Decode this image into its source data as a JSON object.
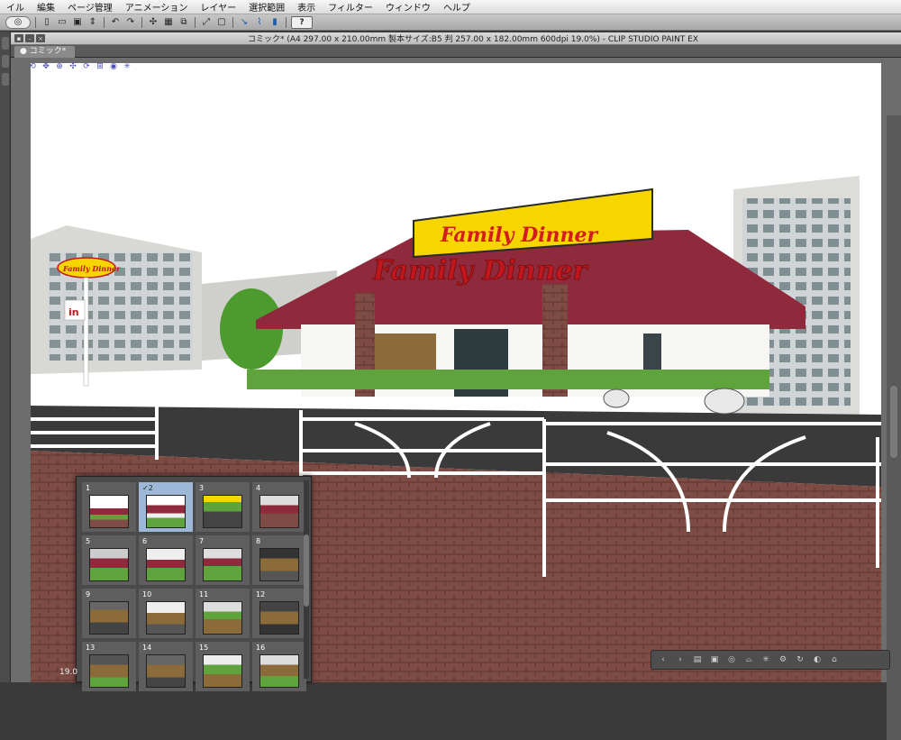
{
  "menubar": {
    "items": [
      "イル",
      "編集",
      "ページ管理",
      "アニメーション",
      "レイヤー",
      "選択範囲",
      "表示",
      "フィルター",
      "ウィンドウ",
      "ヘルプ"
    ]
  },
  "toolbar": {
    "icons": [
      "clip-studio-logo-icon",
      "new-file-icon",
      "open-file-icon",
      "save-icon",
      "undo-icon",
      "redo-icon",
      "transform-icon",
      "fit-icon",
      "crop-icon",
      "ruler-icon",
      "pen-icon",
      "help-icon"
    ],
    "help_label": "?"
  },
  "document": {
    "title": "コミック* (A4 297.00 x 210.00mm 製本サイズ:B5 判 257.00 x 182.00mm 600dpi 19.0%)  - CLIP STUDIO PAINT EX",
    "tab_label": "コミック*",
    "zoom_readout": "19.0"
  },
  "scene": {
    "sign_label": "Family Dinner",
    "pole_sign_label": "Family Dinner",
    "entrance_label": "in",
    "colors": {
      "roof": "#8f2a3c",
      "sign_bg": "#f7d600",
      "sign_text": "#d21d1d",
      "brick": "#7e4b45",
      "sky": "#ffffff"
    }
  },
  "page_thumbnails": {
    "selected": 2,
    "pages": [
      {
        "number": "1",
        "checked": false
      },
      {
        "number": "2",
        "checked": true
      },
      {
        "number": "3",
        "checked": false
      },
      {
        "number": "4",
        "checked": false
      },
      {
        "number": "5",
        "checked": false
      },
      {
        "number": "6",
        "checked": false
      },
      {
        "number": "7",
        "checked": false
      },
      {
        "number": "8",
        "checked": false
      },
      {
        "number": "9",
        "checked": false
      },
      {
        "number": "10",
        "checked": false
      },
      {
        "number": "11",
        "checked": false
      },
      {
        "number": "12",
        "checked": false
      },
      {
        "number": "13",
        "checked": false
      },
      {
        "number": "14",
        "checked": false
      },
      {
        "number": "15",
        "checked": false
      },
      {
        "number": "16",
        "checked": false
      }
    ]
  }
}
